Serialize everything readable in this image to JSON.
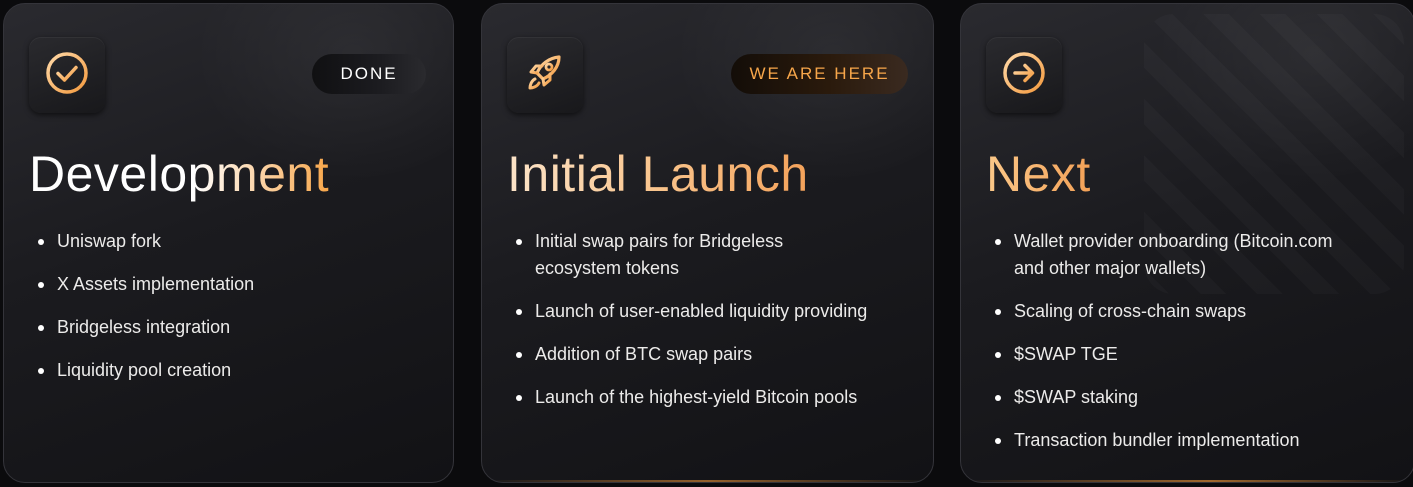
{
  "colors": {
    "accent": "#f7a64a",
    "card_bg": "#1b1b1f",
    "text": "#ecebea"
  },
  "cards": [
    {
      "icon": "check-circle-icon",
      "badge": "DONE",
      "title": "Development",
      "items": [
        "Uniswap fork",
        "X Assets implementation",
        "Bridgeless integration",
        "Liquidity pool creation"
      ]
    },
    {
      "icon": "rocket-icon",
      "badge": "WE ARE HERE",
      "title": "Initial Launch",
      "items": [
        "Initial swap pairs for Bridgeless ecosystem tokens",
        "Launch of user-enabled liquidity providing",
        "Addition of BTC swap pairs",
        "Launch of the highest-yield Bitcoin pools"
      ]
    },
    {
      "icon": "arrow-right-circle-icon",
      "title": "Next",
      "items": [
        "Wallet provider onboarding (Bitcoin.com and other major wallets)",
        "Scaling of cross-chain swaps",
        "$SWAP TGE",
        "$SWAP staking",
        "Transaction bundler implementation"
      ]
    }
  ]
}
